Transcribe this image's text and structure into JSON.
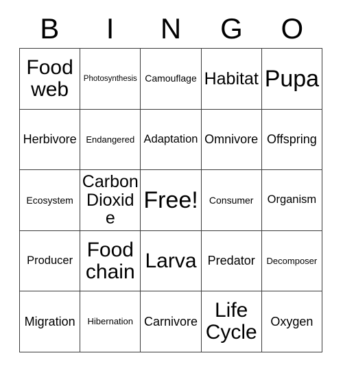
{
  "card": {
    "title": "BINGO",
    "header_letters": [
      "B",
      "I",
      "N",
      "G",
      "O"
    ],
    "rows": 5,
    "columns": 5,
    "colors": {
      "background": "#ffffff",
      "text": "#000000",
      "grid_line": "#3a3a3a"
    },
    "free_space": "Free!",
    "cells": [
      {
        "label": "Food web",
        "size": "xxl",
        "column": "B",
        "row": 1
      },
      {
        "label": "Photosynthesis",
        "size": "xs",
        "column": "I",
        "row": 1
      },
      {
        "label": "Camouflage",
        "size": "sm",
        "column": "N",
        "row": 1
      },
      {
        "label": "Habitat",
        "size": "xl",
        "column": "G",
        "row": 1
      },
      {
        "label": "Pupa",
        "size": "huge",
        "column": "O",
        "row": 1
      },
      {
        "label": "Herbivore",
        "size": "ml",
        "column": "B",
        "row": 2
      },
      {
        "label": "Endangered",
        "size": "s",
        "column": "I",
        "row": 2
      },
      {
        "label": "Adaptation",
        "size": "m",
        "column": "N",
        "row": 2
      },
      {
        "label": "Omnivore",
        "size": "ml",
        "column": "G",
        "row": 2
      },
      {
        "label": "Offspring",
        "size": "ml",
        "column": "O",
        "row": 2
      },
      {
        "label": "Ecosystem",
        "size": "sm",
        "column": "B",
        "row": 3
      },
      {
        "label": "Carbon Dioxide",
        "size": "xl",
        "column": "I",
        "row": 3
      },
      {
        "label": "Free!",
        "size": "huge",
        "column": "N",
        "row": 3
      },
      {
        "label": "Consumer",
        "size": "sm",
        "column": "G",
        "row": 3
      },
      {
        "label": "Organism",
        "size": "m",
        "column": "O",
        "row": 3
      },
      {
        "label": "Producer",
        "size": "m",
        "column": "B",
        "row": 4
      },
      {
        "label": "Food chain",
        "size": "xxl",
        "column": "I",
        "row": 4
      },
      {
        "label": "Larva",
        "size": "xxl",
        "column": "N",
        "row": 4
      },
      {
        "label": "Predator",
        "size": "ml",
        "column": "G",
        "row": 4
      },
      {
        "label": "Decomposer",
        "size": "s",
        "column": "O",
        "row": 4
      },
      {
        "label": "Migration",
        "size": "ml",
        "column": "B",
        "row": 5
      },
      {
        "label": "Hibernation",
        "size": "s",
        "column": "I",
        "row": 5
      },
      {
        "label": "Carnivore",
        "size": "ml",
        "column": "N",
        "row": 5
      },
      {
        "label": "Life Cycle",
        "size": "xxl",
        "column": "G",
        "row": 5
      },
      {
        "label": "Oxygen",
        "size": "ml",
        "column": "O",
        "row": 5
      }
    ]
  }
}
